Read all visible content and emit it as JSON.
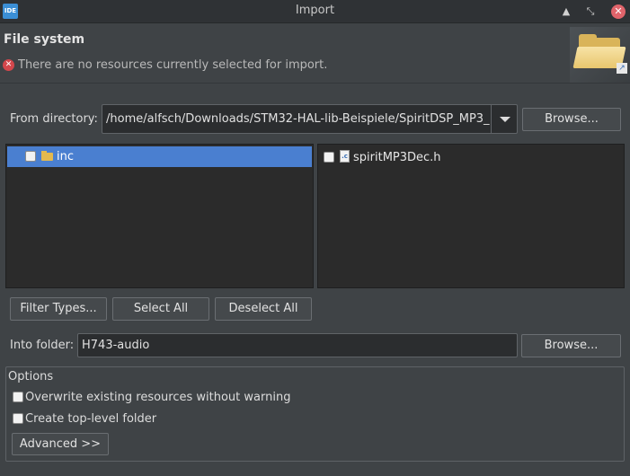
{
  "window": {
    "app_icon_text": "IDE",
    "title": "Import",
    "minimize_glyph": "▲",
    "maximize_glyph": "⤡",
    "close_glyph": "✕"
  },
  "header": {
    "title": "File system",
    "message": "There are no resources currently selected for import.",
    "error_icon": "error-icon",
    "banner_icon": "folder-import-icon"
  },
  "from_directory": {
    "label": "From directory:",
    "value": "/home/alfsch/Downloads/STM32-HAL-lib-Beispiele/SpiritDSP_MP3_",
    "browse_label": "Browse..."
  },
  "folder_tree": {
    "items": [
      {
        "label": "inc",
        "checked": false,
        "selected": true,
        "icon": "open-folder-icon"
      }
    ]
  },
  "file_list": {
    "items": [
      {
        "label": "spiritMP3Dec.h",
        "checked": false,
        "icon": "c-header-file-icon"
      }
    ]
  },
  "selection_buttons": {
    "filter_types": "Filter Types...",
    "select_all": "Select All",
    "deselect_all": "Deselect All"
  },
  "into_folder": {
    "label": "Into folder:",
    "value": "H743-audio",
    "browse_label": "Browse..."
  },
  "options": {
    "title": "Options",
    "overwrite_label": "Overwrite existing resources without warning",
    "overwrite_checked": false,
    "create_top_level_label": "Create top-level folder",
    "create_top_level_checked": false,
    "advanced_label": "Advanced >>"
  },
  "colors": {
    "background": "#3f4346",
    "selection": "#4a7fd0",
    "pane_background": "#2b2b2b",
    "error": "#d3474c",
    "close_button": "#e0646b"
  }
}
